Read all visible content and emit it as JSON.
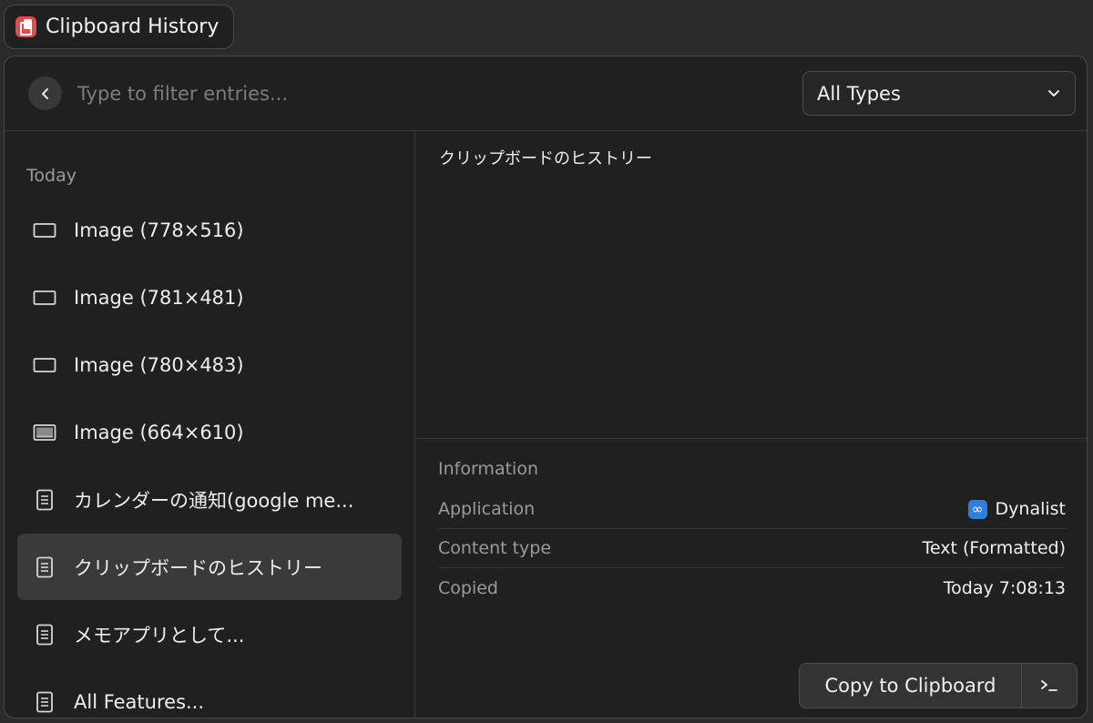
{
  "window": {
    "title": "Clipboard History"
  },
  "search": {
    "placeholder": "Type to filter entries...",
    "value": ""
  },
  "filter": {
    "selected": "All Types"
  },
  "list": {
    "section": "Today",
    "items": [
      {
        "label": "Image (778×516)",
        "icon": "image-icon"
      },
      {
        "label": "Image (781×481)",
        "icon": "image-icon"
      },
      {
        "label": "Image (780×483)",
        "icon": "image-icon"
      },
      {
        "label": "Image (664×610)",
        "icon": "image-icon"
      },
      {
        "label": "カレンダーの通知(google me...",
        "icon": "document-icon"
      },
      {
        "label": "クリップボードのヒストリー",
        "icon": "document-icon"
      },
      {
        "label": "メモアプリとして...",
        "icon": "document-icon"
      },
      {
        "label": "All Features...",
        "icon": "document-icon"
      }
    ],
    "selected_index": 5
  },
  "detail": {
    "preview_text": "クリップボードのヒストリー",
    "info_title": "Information",
    "rows": [
      {
        "key": "Application",
        "value": "Dynalist",
        "icon": "dynalist-icon"
      },
      {
        "key": "Content type",
        "value": "Text (Formatted)"
      },
      {
        "key": "Copied",
        "value": "Today 7:08:13"
      }
    ]
  },
  "actions": {
    "primary": "Copy to Clipboard",
    "secondary_icon": "terminal-icon"
  },
  "colors": {
    "app_icon": "#e8484a",
    "dynalist_icon": "#2f7fe0",
    "selection": "#3a3a3c"
  }
}
